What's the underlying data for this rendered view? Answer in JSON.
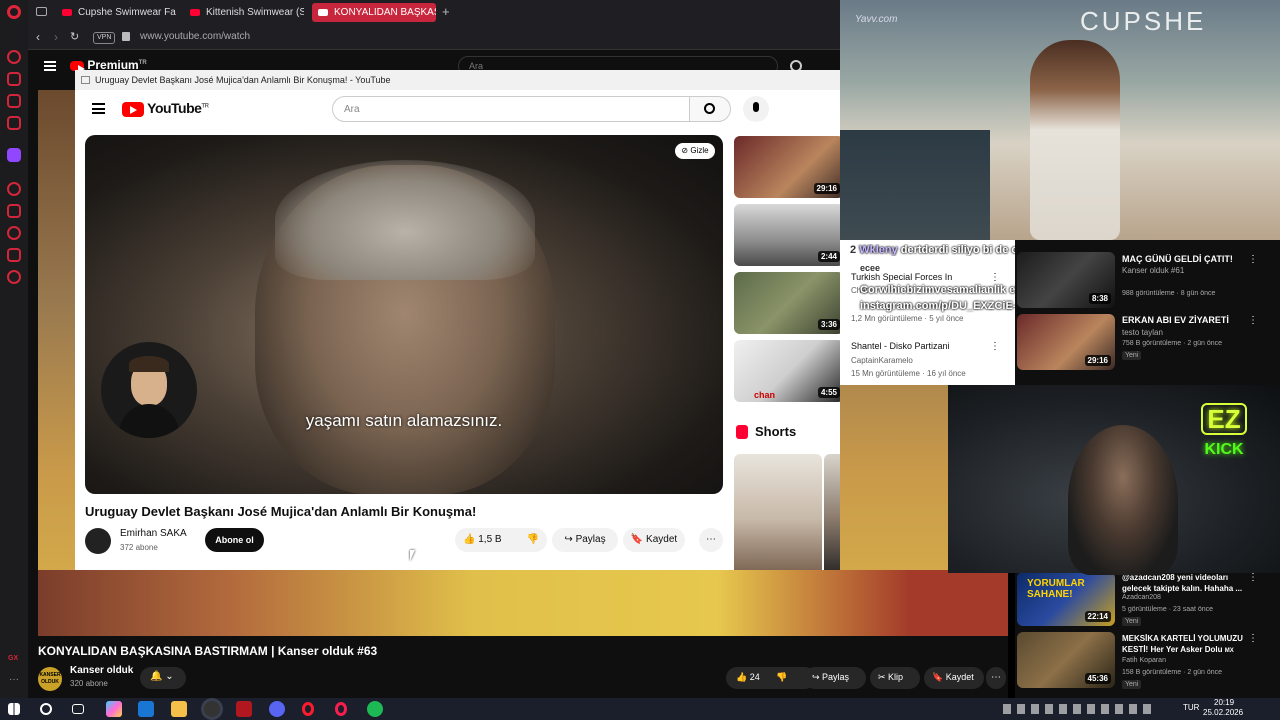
{
  "tabs": [
    {
      "label": "Cupshe Swimwear Fashio"
    },
    {
      "label": "Kittenish Swimwear (Slow"
    },
    {
      "label": "KONYALIDAN BAŞKASINA"
    }
  ],
  "address": {
    "vpn": "VPN",
    "url": "www.youtube.com/watch"
  },
  "bg": {
    "premium": "Premium",
    "premium_tr": "TR",
    "search_placeholder": "Ara",
    "video_title": "KONYALIDAN BAŞKASINA BASTIRMAM | Kanser olduk #63",
    "channel": "Kanser olduk",
    "subs": "320 abone",
    "likes": "24",
    "share": "Paylaş",
    "clip": "Klip",
    "save": "Kaydet",
    "channel_logo_text": "KANSER OLDUK"
  },
  "popup": {
    "window_title": "Uruguay Devlet Başkanı José Mujica'dan Anlamlı Bir Konuşma! - YouTube",
    "logo_text": "YouTube",
    "logo_tr": "TR",
    "search_placeholder": "Ara",
    "hide_label": "Gizle",
    "subtitle": "yaşamı satın alamazsınız.",
    "video_title": "Uruguay Devlet Başkanı José Mujica'dan Anlamlı Bir Konuşma!",
    "channel": "Emirhan SAKA",
    "subs": "372 abone",
    "subscribe": "Abone ol",
    "likes": "1,5 B",
    "share": "Paylaş",
    "save": "Kaydet",
    "shorts": "Shorts"
  },
  "popup_side": [
    {
      "duration": "29:16"
    },
    {
      "duration": "2:44"
    },
    {
      "duration": "3:36",
      "title": "Turkish Special Forces In",
      "channel": "Chat",
      "stats": "1,2 Mn görüntüleme · 5 yıl önce"
    },
    {
      "duration": "4:55",
      "title": "Shantel - Disko Partizani",
      "channel": "CaptainKaramelo",
      "stats": "15 Mn görüntüleme · 16 yıl önce",
      "thumb_text": "chan"
    }
  ],
  "chat_overlay": {
    "line1_prefix": "2",
    "user": "Wkleny",
    "msg1": "dertderdi siliyo bi de olmamış kızının saçını tarıçam şimdi g",
    "msg2": "ecee",
    "msg3": "Corwlhiebizimvesamalianlik ekrediru",
    "msg4": "instagram.com/p/DU_EXZCiE-S/"
  },
  "right_list": [
    {
      "title": "MAÇ GÜNÜ GELDİ ÇATIT!",
      "channel": "Kanser olduk #61",
      "stats": "988 görüntüleme · 8 gün önce",
      "duration": "8:38"
    },
    {
      "title": "ERKAN ABI EV ZİYARETİ",
      "channel": "testo taylan",
      "stats": "758 B görüntüleme · 2 gün önce",
      "badge": "Yeni",
      "duration": "29:16"
    },
    {
      "title": "@azadcan208 yeni videoları gelecek takipte kalın. Hahaha ...",
      "channel": "Azadcan208",
      "stats": "5 görüntüleme · 23 saat önce",
      "badge": "Yeni",
      "duration": "22:14",
      "thumb_text": "YORUMLAR SAHANE!"
    },
    {
      "title": "MEKSİKA KARTELİ YOLUMUZU KESTİ! Her Yer Asker Dolu",
      "channel": "Fatih Koparan",
      "stats": "158 B görüntüleme · 2 gün önce",
      "badge": "Yeni",
      "duration": "45:36",
      "tag": "MX"
    }
  ],
  "streamer": {
    "sign_top": "EZ",
    "sign_bottom": "KICK"
  },
  "runway": {
    "watermark": "Yavv.com",
    "brand": "CUPSHE"
  },
  "taskbar": {
    "lang": "TUR",
    "time": "20:19",
    "date": "25.02.2026"
  },
  "opera_side": {
    "bottom": "GX"
  }
}
